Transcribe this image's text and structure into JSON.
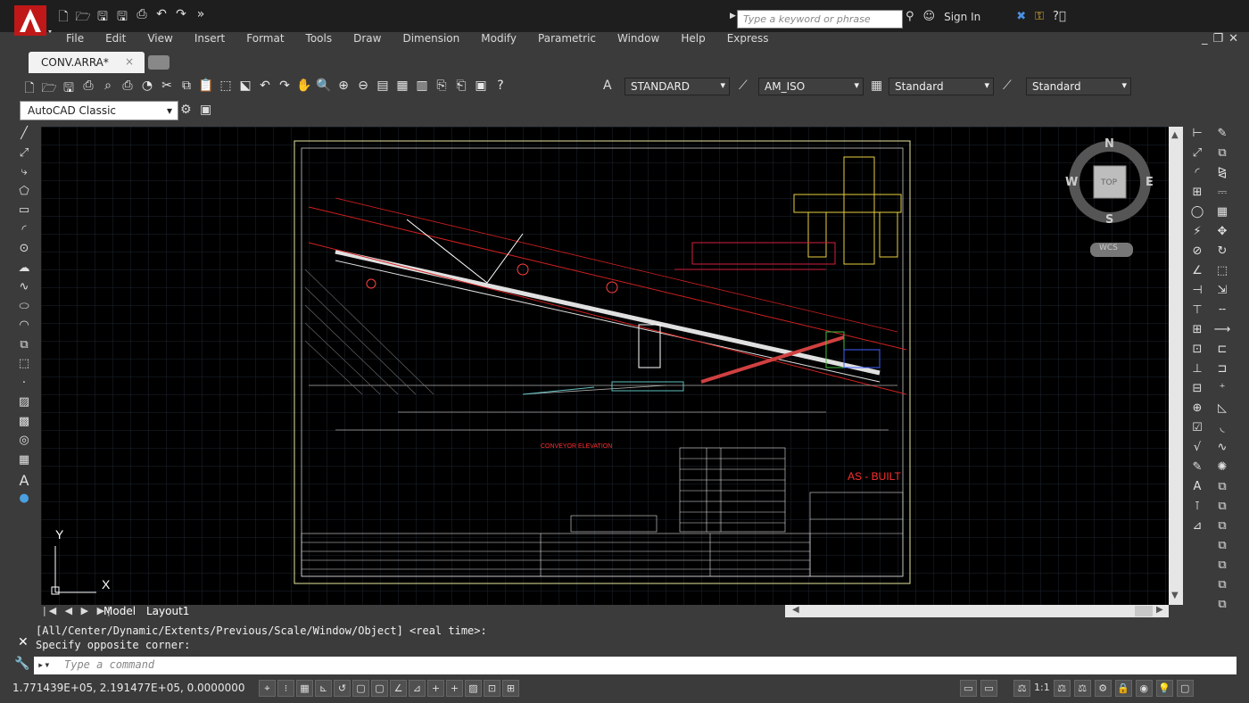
{
  "title_bar": {
    "search_placeholder": "Type a keyword or phrase",
    "sign_in": "Sign In"
  },
  "menu": [
    "File",
    "Edit",
    "View",
    "Insert",
    "Format",
    "Tools",
    "Draw",
    "Dimension",
    "Modify",
    "Parametric",
    "Window",
    "Help",
    "Express"
  ],
  "document_tab": {
    "label": "CONV.ARRA*",
    "close": "×"
  },
  "toolbar": {
    "text_style": "STANDARD",
    "dim_style": "AM_ISO",
    "table_style": "Standard",
    "multileader_style": "Standard",
    "workspace": "AutoCAD Classic"
  },
  "viewcube": {
    "north": "N",
    "south": "S",
    "east": "E",
    "west": "W",
    "top": "TOP",
    "wcs": "WCS"
  },
  "ucs": {
    "x": "X",
    "y": "Y"
  },
  "layout_tabs": {
    "model": "Model",
    "layout1": "Layout1"
  },
  "command_line": {
    "history": [
      "[All/Center/Dynamic/Extents/Previous/Scale/Window/Object] <real time>:",
      "Specify opposite corner:"
    ],
    "placeholder": "Type a command"
  },
  "status_bar": {
    "coordinates": "1.771439E+05, 2.191477E+05, 0.0000000",
    "annotation_scale": "1:1"
  },
  "drawing": {
    "stamp": "AS - BUILT",
    "elevation_title": "CONVEYOR ELEVATION"
  },
  "colors": {
    "accent_red": "#d0202a",
    "model_space": "#000000",
    "grid": "#1e2a36"
  }
}
